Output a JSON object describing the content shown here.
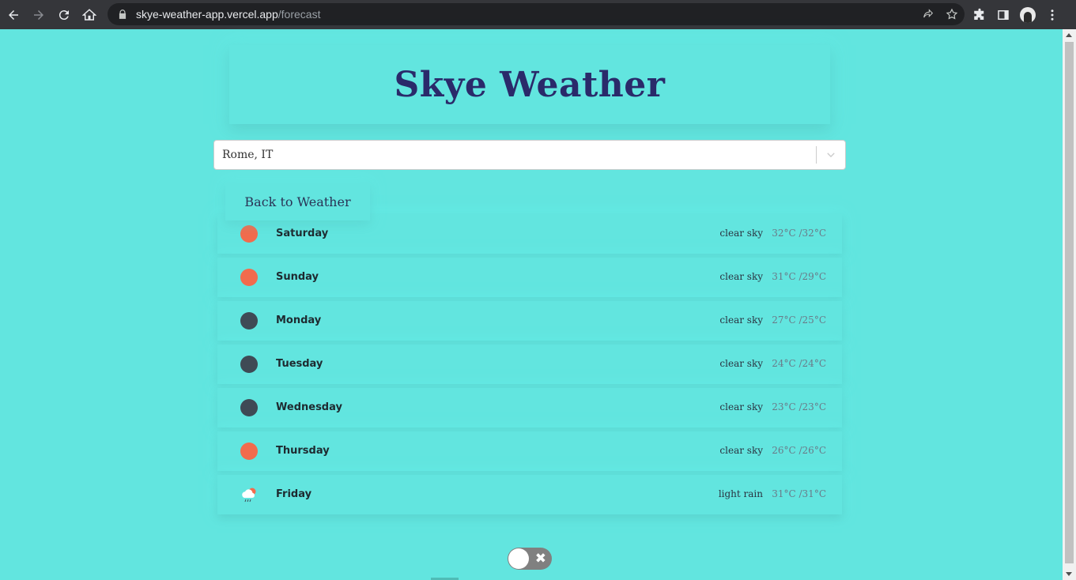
{
  "browser": {
    "url_domain": "skye-weather-app.vercel.app",
    "url_path": "/forecast"
  },
  "app": {
    "title": "Skye Weather",
    "location_select": {
      "value": "Rome, IT"
    },
    "back_button_label": "Back to Weather"
  },
  "forecast": [
    {
      "day": "Saturday",
      "icon": "sun-icon",
      "description": "clear sky",
      "temp": "32°C /32°C"
    },
    {
      "day": "Sunday",
      "icon": "sun-icon",
      "description": "clear sky",
      "temp": "31°C /29°C"
    },
    {
      "day": "Monday",
      "icon": "moon-icon",
      "description": "clear sky",
      "temp": "27°C /25°C"
    },
    {
      "day": "Tuesday",
      "icon": "moon-icon",
      "description": "clear sky",
      "temp": "24°C /24°C"
    },
    {
      "day": "Wednesday",
      "icon": "moon-icon",
      "description": "clear sky",
      "temp": "23°C /23°C"
    },
    {
      "day": "Thursday",
      "icon": "sun-icon",
      "description": "clear sky",
      "temp": "26°C /26°C"
    },
    {
      "day": "Friday",
      "icon": "rain-cloud-icon",
      "description": "light rain",
      "temp": "31°C /31°C"
    }
  ],
  "theme_toggle": {
    "state": "off",
    "icon": "close-icon"
  },
  "colors": {
    "background": "#62e5df",
    "title": "#2a2a6a",
    "sun": "#f26b4d",
    "night": "#3f4a55"
  }
}
